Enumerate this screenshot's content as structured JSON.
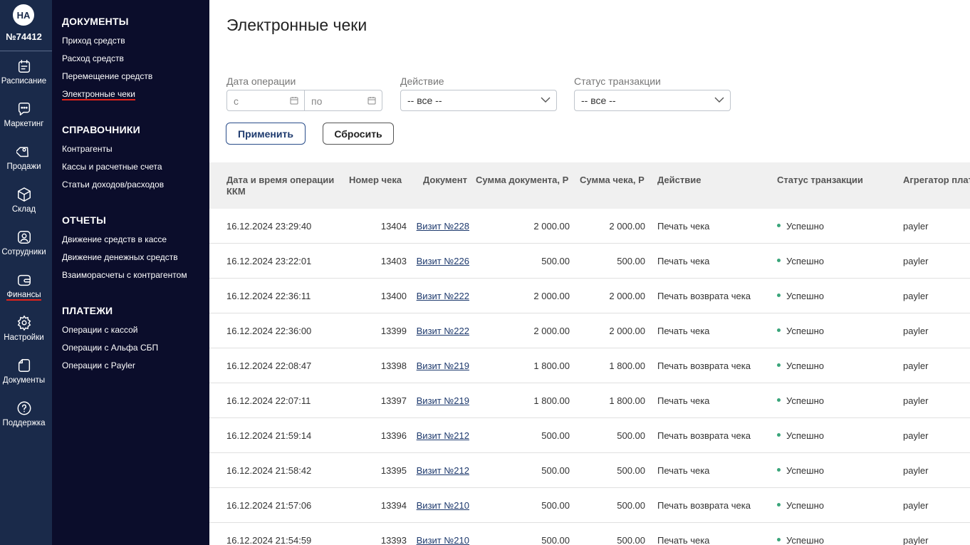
{
  "account": {
    "initials": "НА",
    "number": "№74412"
  },
  "rail": {
    "items": [
      {
        "label": "Расписание",
        "icon": "calendar-icon"
      },
      {
        "label": "Маркетинг",
        "icon": "chat-icon"
      },
      {
        "label": "Продажи",
        "icon": "tag-icon"
      },
      {
        "label": "Склад",
        "icon": "box-icon"
      },
      {
        "label": "Сотрудники",
        "icon": "person-icon"
      },
      {
        "label": "Финансы",
        "icon": "wallet-icon",
        "active": true
      },
      {
        "label": "Настройки",
        "icon": "gear-icon"
      },
      {
        "label": "Документы",
        "icon": "document-icon"
      },
      {
        "label": "Поддержка",
        "icon": "help-icon"
      }
    ]
  },
  "subnav": {
    "sections": [
      {
        "title": "ДОКУМЕНТЫ",
        "links": [
          "Приход средств",
          "Расход средств",
          "Перемещение средств",
          "Электронные чеки"
        ]
      },
      {
        "title": "СПРАВОЧНИКИ",
        "links": [
          "Контрагенты",
          "Кассы и расчетные счета",
          "Статьи доходов/расходов"
        ]
      },
      {
        "title": "ОТЧЕТЫ",
        "links": [
          "Движение средств в кассе",
          "Движение денежных средств",
          "Взаиморасчеты с контрагентом"
        ]
      },
      {
        "title": "ПЛАТЕЖИ",
        "links": [
          "Операции с кассой",
          "Операции с Альфа СБП",
          "Операции с Payler"
        ]
      }
    ],
    "active_link": "Электронные чеки"
  },
  "page": {
    "title": "Электронные чеки"
  },
  "filters": {
    "date_label": "Дата операции",
    "date_from_placeholder": "с",
    "date_to_placeholder": "по",
    "action_label": "Действие",
    "action_value": "-- все --",
    "status_label": "Статус транзакции",
    "status_value": "-- все --",
    "apply_label": "Применить",
    "reset_label": "Сбросить"
  },
  "table": {
    "columns": [
      "Дата и время операции ККМ",
      "Номер чека",
      "Документ",
      "Сумма документа, Р",
      "Сумма чека, Р",
      "Действие",
      "Статус транзакции",
      "Агрегатор плат"
    ],
    "rows": [
      [
        "16.12.2024 23:29:40",
        "13404",
        "Визит №228",
        "2 000.00",
        "2 000.00",
        "Печать чека",
        "Успешно",
        "payler"
      ],
      [
        "16.12.2024 23:22:01",
        "13403",
        "Визит №226",
        "500.00",
        "500.00",
        "Печать чека",
        "Успешно",
        "payler"
      ],
      [
        "16.12.2024 22:36:11",
        "13400",
        "Визит №222",
        "2 000.00",
        "2 000.00",
        "Печать возврата чека",
        "Успешно",
        "payler"
      ],
      [
        "16.12.2024 22:36:00",
        "13399",
        "Визит №222",
        "2 000.00",
        "2 000.00",
        "Печать чека",
        "Успешно",
        "payler"
      ],
      [
        "16.12.2024 22:08:47",
        "13398",
        "Визит №219",
        "1 800.00",
        "1 800.00",
        "Печать возврата чека",
        "Успешно",
        "payler"
      ],
      [
        "16.12.2024 22:07:11",
        "13397",
        "Визит №219",
        "1 800.00",
        "1 800.00",
        "Печать чека",
        "Успешно",
        "payler"
      ],
      [
        "16.12.2024 21:59:14",
        "13396",
        "Визит №212",
        "500.00",
        "500.00",
        "Печать возврата чека",
        "Успешно",
        "payler"
      ],
      [
        "16.12.2024 21:58:42",
        "13395",
        "Визит №212",
        "500.00",
        "500.00",
        "Печать чека",
        "Успешно",
        "payler"
      ],
      [
        "16.12.2024 21:57:06",
        "13394",
        "Визит №210",
        "500.00",
        "500.00",
        "Печать возврата чека",
        "Успешно",
        "payler"
      ],
      [
        "16.12.2024 21:54:59",
        "13393",
        "Визит №210",
        "500.00",
        "500.00",
        "Печать чека",
        "Успешно",
        "payler"
      ]
    ]
  },
  "colors": {
    "rail_bg": "#1a2a4a",
    "subnav_bg": "#0b0d2b",
    "accent_red": "#e2231a",
    "primary_blue": "#1e3a6e",
    "status_green": "#3aa57a"
  }
}
